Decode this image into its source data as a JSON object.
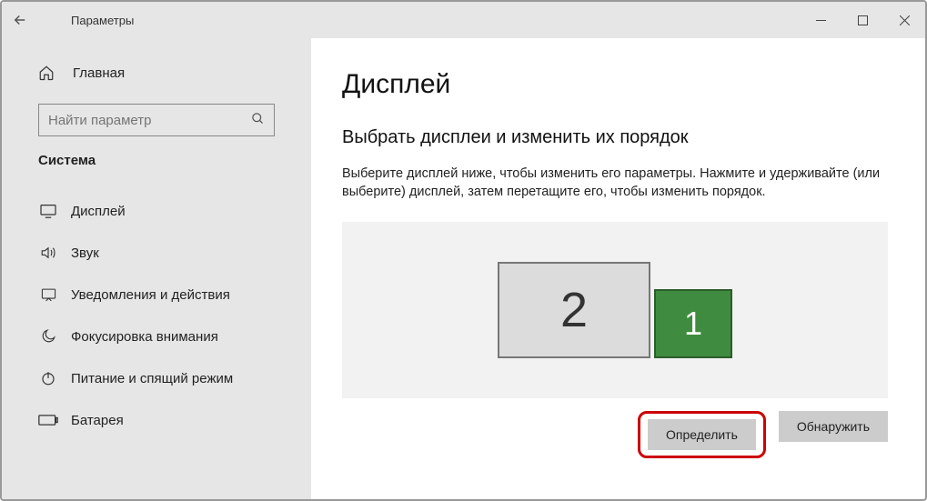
{
  "titlebar": {
    "title": "Параметры"
  },
  "sidebar": {
    "home": "Главная",
    "search_placeholder": "Найти параметр",
    "category": "Система",
    "items": [
      {
        "label": "Дисплей"
      },
      {
        "label": "Звук"
      },
      {
        "label": "Уведомления и действия"
      },
      {
        "label": "Фокусировка внимания"
      },
      {
        "label": "Питание и спящий режим"
      },
      {
        "label": "Батарея"
      }
    ]
  },
  "main": {
    "page_title": "Дисплей",
    "section_title": "Выбрать дисплеи и изменить их порядок",
    "section_desc": "Выберите дисплей ниже, чтобы изменить его параметры. Нажмите и удерживайте (или выберите) дисплей, затем перетащите его, чтобы изменить порядок.",
    "monitor1": "1",
    "monitor2": "2",
    "identify_btn": "Определить",
    "detect_btn": "Обнаружить"
  }
}
